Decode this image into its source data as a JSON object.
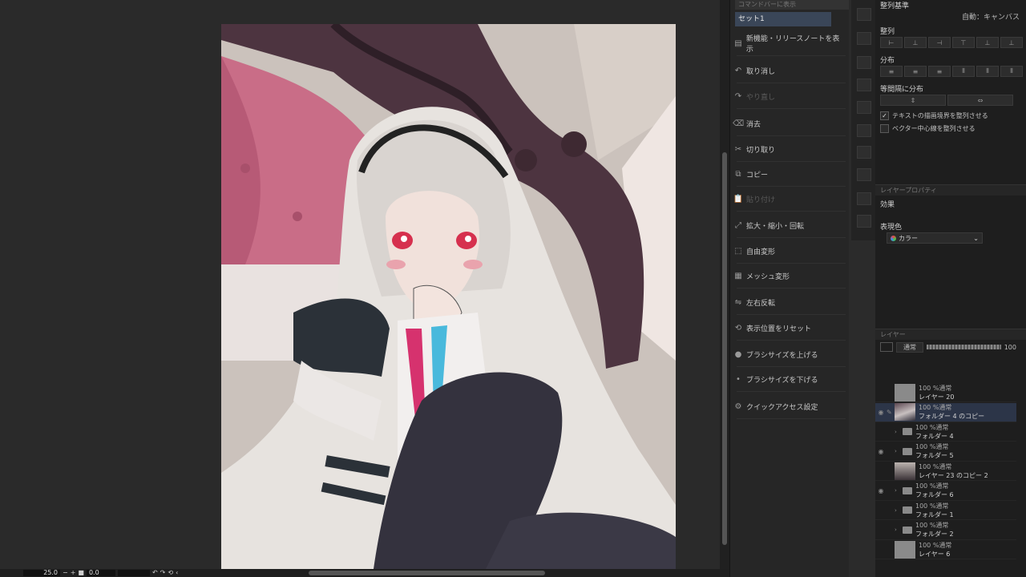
{
  "status_bar": {
    "zoom": "25.0",
    "angle": "0.0"
  },
  "context_menu": {
    "header_label": "コマンドバーに表示",
    "selected": "セット1",
    "items": [
      {
        "label": "新機能・リリースノートを表示",
        "icon": "release-notes-icon",
        "enabled": true
      },
      {
        "label": "取り消し",
        "icon": "undo-icon",
        "enabled": true
      },
      {
        "label": "やり直し",
        "icon": "redo-icon",
        "enabled": false
      },
      {
        "label": "消去",
        "icon": "erase-icon",
        "enabled": true
      },
      {
        "label": "切り取り",
        "icon": "cut-icon",
        "enabled": true
      },
      {
        "label": "コピー",
        "icon": "copy-icon",
        "enabled": true
      },
      {
        "label": "貼り付け",
        "icon": "paste-icon",
        "enabled": false
      },
      {
        "label": "拡大・縮小・回転",
        "icon": "transform-icon",
        "enabled": true
      },
      {
        "label": "自由変形",
        "icon": "free-transform-icon",
        "enabled": true
      },
      {
        "label": "メッシュ変形",
        "icon": "mesh-transform-icon",
        "enabled": true
      },
      {
        "label": "左右反転",
        "icon": "flip-icon",
        "enabled": true
      },
      {
        "label": "表示位置をリセット",
        "icon": "reset-view-icon",
        "enabled": true
      },
      {
        "label": "ブラシサイズを上げる",
        "icon": "brush-up-icon",
        "enabled": true
      },
      {
        "label": "ブラシサイズを下げる",
        "icon": "brush-down-icon",
        "enabled": true
      },
      {
        "label": "クイックアクセス設定",
        "icon": "settings-icon",
        "enabled": true
      }
    ]
  },
  "align_panel": {
    "title": "整列基準",
    "mode": "自動：キャンバス",
    "align_label": "整列",
    "distribute_label": "分布",
    "spacing_label": "等間隔に分布",
    "check_text_bounds": "テキストの描画境界を整列させる",
    "check_vector_center": "ベクター中心線を整列させる",
    "check_text_bounds_on": true,
    "check_vector_center_on": false
  },
  "property_panel": {
    "tab": "レイヤープロパティ",
    "effect_label": "効果",
    "color_label": "表現色",
    "color_value": "カラー"
  },
  "layer_panel": {
    "tab": "レイヤー",
    "blend_mode": "通常",
    "opacity": "100",
    "layers": [
      {
        "mode": "100 %通常",
        "name": "レイヤー 20",
        "type": "layer",
        "thumb": "gray",
        "visible": false,
        "selected": false
      },
      {
        "mode": "100 %通常",
        "name": "フォルダー 4 のコピー",
        "type": "layer",
        "thumb": "art",
        "visible": true,
        "selected": true
      },
      {
        "mode": "100 %通常",
        "name": "フォルダー 4",
        "type": "folder",
        "visible": false,
        "selected": false
      },
      {
        "mode": "100 %通常",
        "name": "フォルダー 5",
        "type": "folder",
        "visible": true,
        "selected": false
      },
      {
        "mode": "100 %通常",
        "name": "レイヤー 23 のコピー 2",
        "type": "layer",
        "thumb": "dark",
        "visible": false,
        "selected": false
      },
      {
        "mode": "100 %通常",
        "name": "フォルダー 6",
        "type": "folder",
        "visible": true,
        "selected": false
      },
      {
        "mode": "100 %通常",
        "name": "フォルダー 1",
        "type": "folder",
        "visible": false,
        "selected": false
      },
      {
        "mode": "100 %通常",
        "name": "フォルダー 2",
        "type": "folder",
        "visible": false,
        "selected": false
      },
      {
        "mode": "100 %通常",
        "name": "レイヤー 6",
        "type": "layer",
        "thumb": "gray",
        "visible": false,
        "selected": false
      }
    ]
  }
}
